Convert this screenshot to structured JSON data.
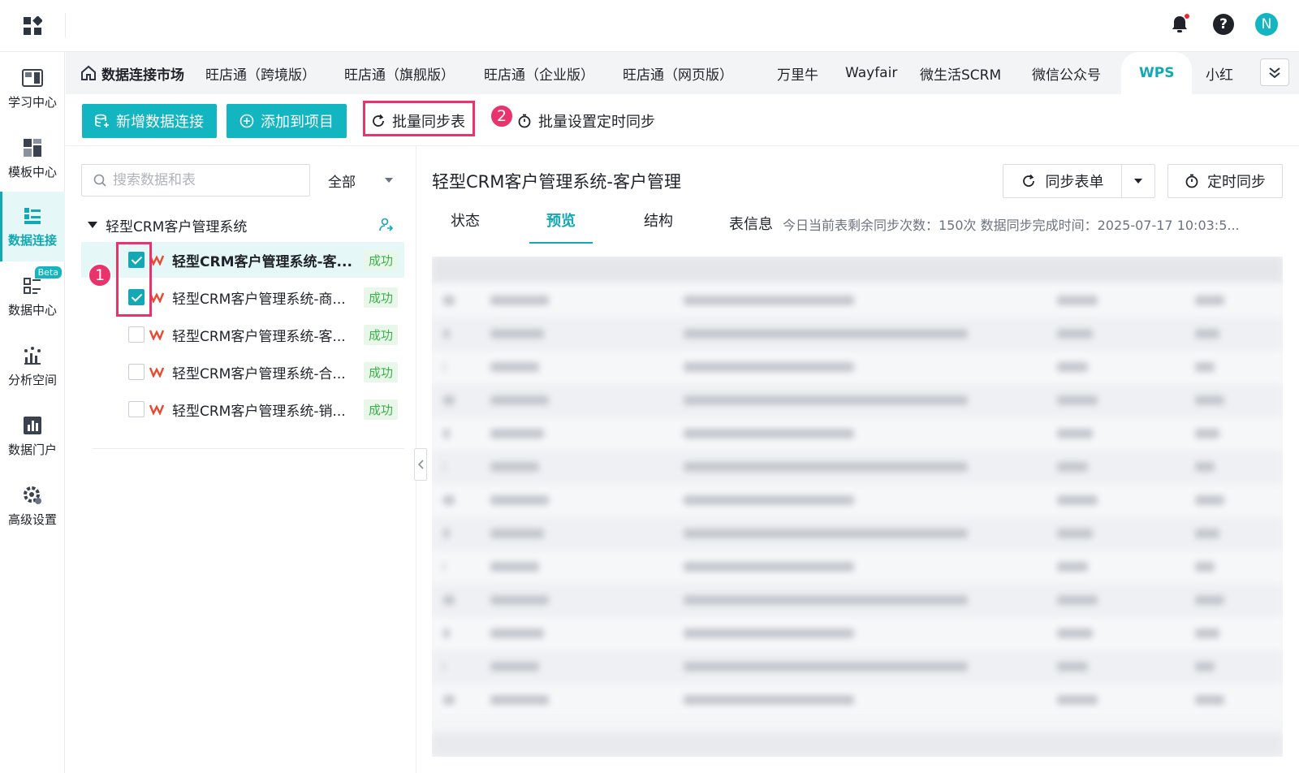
{
  "topbar": {
    "avatar_letter": "N",
    "help_glyph": "?",
    "accent_color": "#13b5c0"
  },
  "leftnav": {
    "items": [
      {
        "label": "学习中心",
        "icon": "study-icon"
      },
      {
        "label": "模板中心",
        "icon": "template-icon"
      },
      {
        "label": "数据连接",
        "icon": "data-connect-icon",
        "active": true
      },
      {
        "label": "数据中心",
        "icon": "data-center-icon",
        "badge": "Beta"
      },
      {
        "label": "分析空间",
        "icon": "analysis-icon"
      },
      {
        "label": "数据门户",
        "icon": "portal-icon"
      },
      {
        "label": "高级设置",
        "icon": "settings-icon"
      }
    ]
  },
  "tabs": [
    {
      "label": "数据连接市场"
    },
    {
      "label": "旺店通（跨境版）"
    },
    {
      "label": "旺店通（旗舰版）"
    },
    {
      "label": "旺店通（企业版）"
    },
    {
      "label": "旺店通（网页版）"
    },
    {
      "label": "万里牛"
    },
    {
      "label": "Wayfair"
    },
    {
      "label": "微生活SCRM"
    },
    {
      "label": "微信公众号"
    },
    {
      "label": "WPS"
    },
    {
      "label": "小红"
    }
  ],
  "toolbar": {
    "add_connection": "新增数据连接",
    "add_to_project": "添加到项目",
    "batch_sync": "批量同步表",
    "batch_schedule": "批量设置定时同步",
    "marker_1": "1",
    "marker_2": "2"
  },
  "left_panel": {
    "search_placeholder": "搜索数据和表",
    "filter_value": "全部",
    "root_label": "轻型CRM客户管理系统",
    "rows": [
      {
        "label": "轻型CRM客户管理系统-客...",
        "status": "成功",
        "checked": true
      },
      {
        "label": "轻型CRM客户管理系统-商...",
        "status": "成功",
        "checked": true
      },
      {
        "label": "轻型CRM客户管理系统-客...",
        "status": "成功",
        "checked": false
      },
      {
        "label": "轻型CRM客户管理系统-合...",
        "status": "成功",
        "checked": false
      },
      {
        "label": "轻型CRM客户管理系统-销...",
        "status": "成功",
        "checked": false
      }
    ]
  },
  "right_panel": {
    "title": "轻型CRM客户管理系统-客户管理",
    "sync_button": "同步表单",
    "timer_button": "定时同步",
    "tabs": [
      "状态",
      "预览",
      "结构"
    ],
    "info_label": "表信息",
    "info_text": "今日当前表剩余同步次数：150次   数据同步完成时间：2025-07-17 10:03:5..."
  }
}
